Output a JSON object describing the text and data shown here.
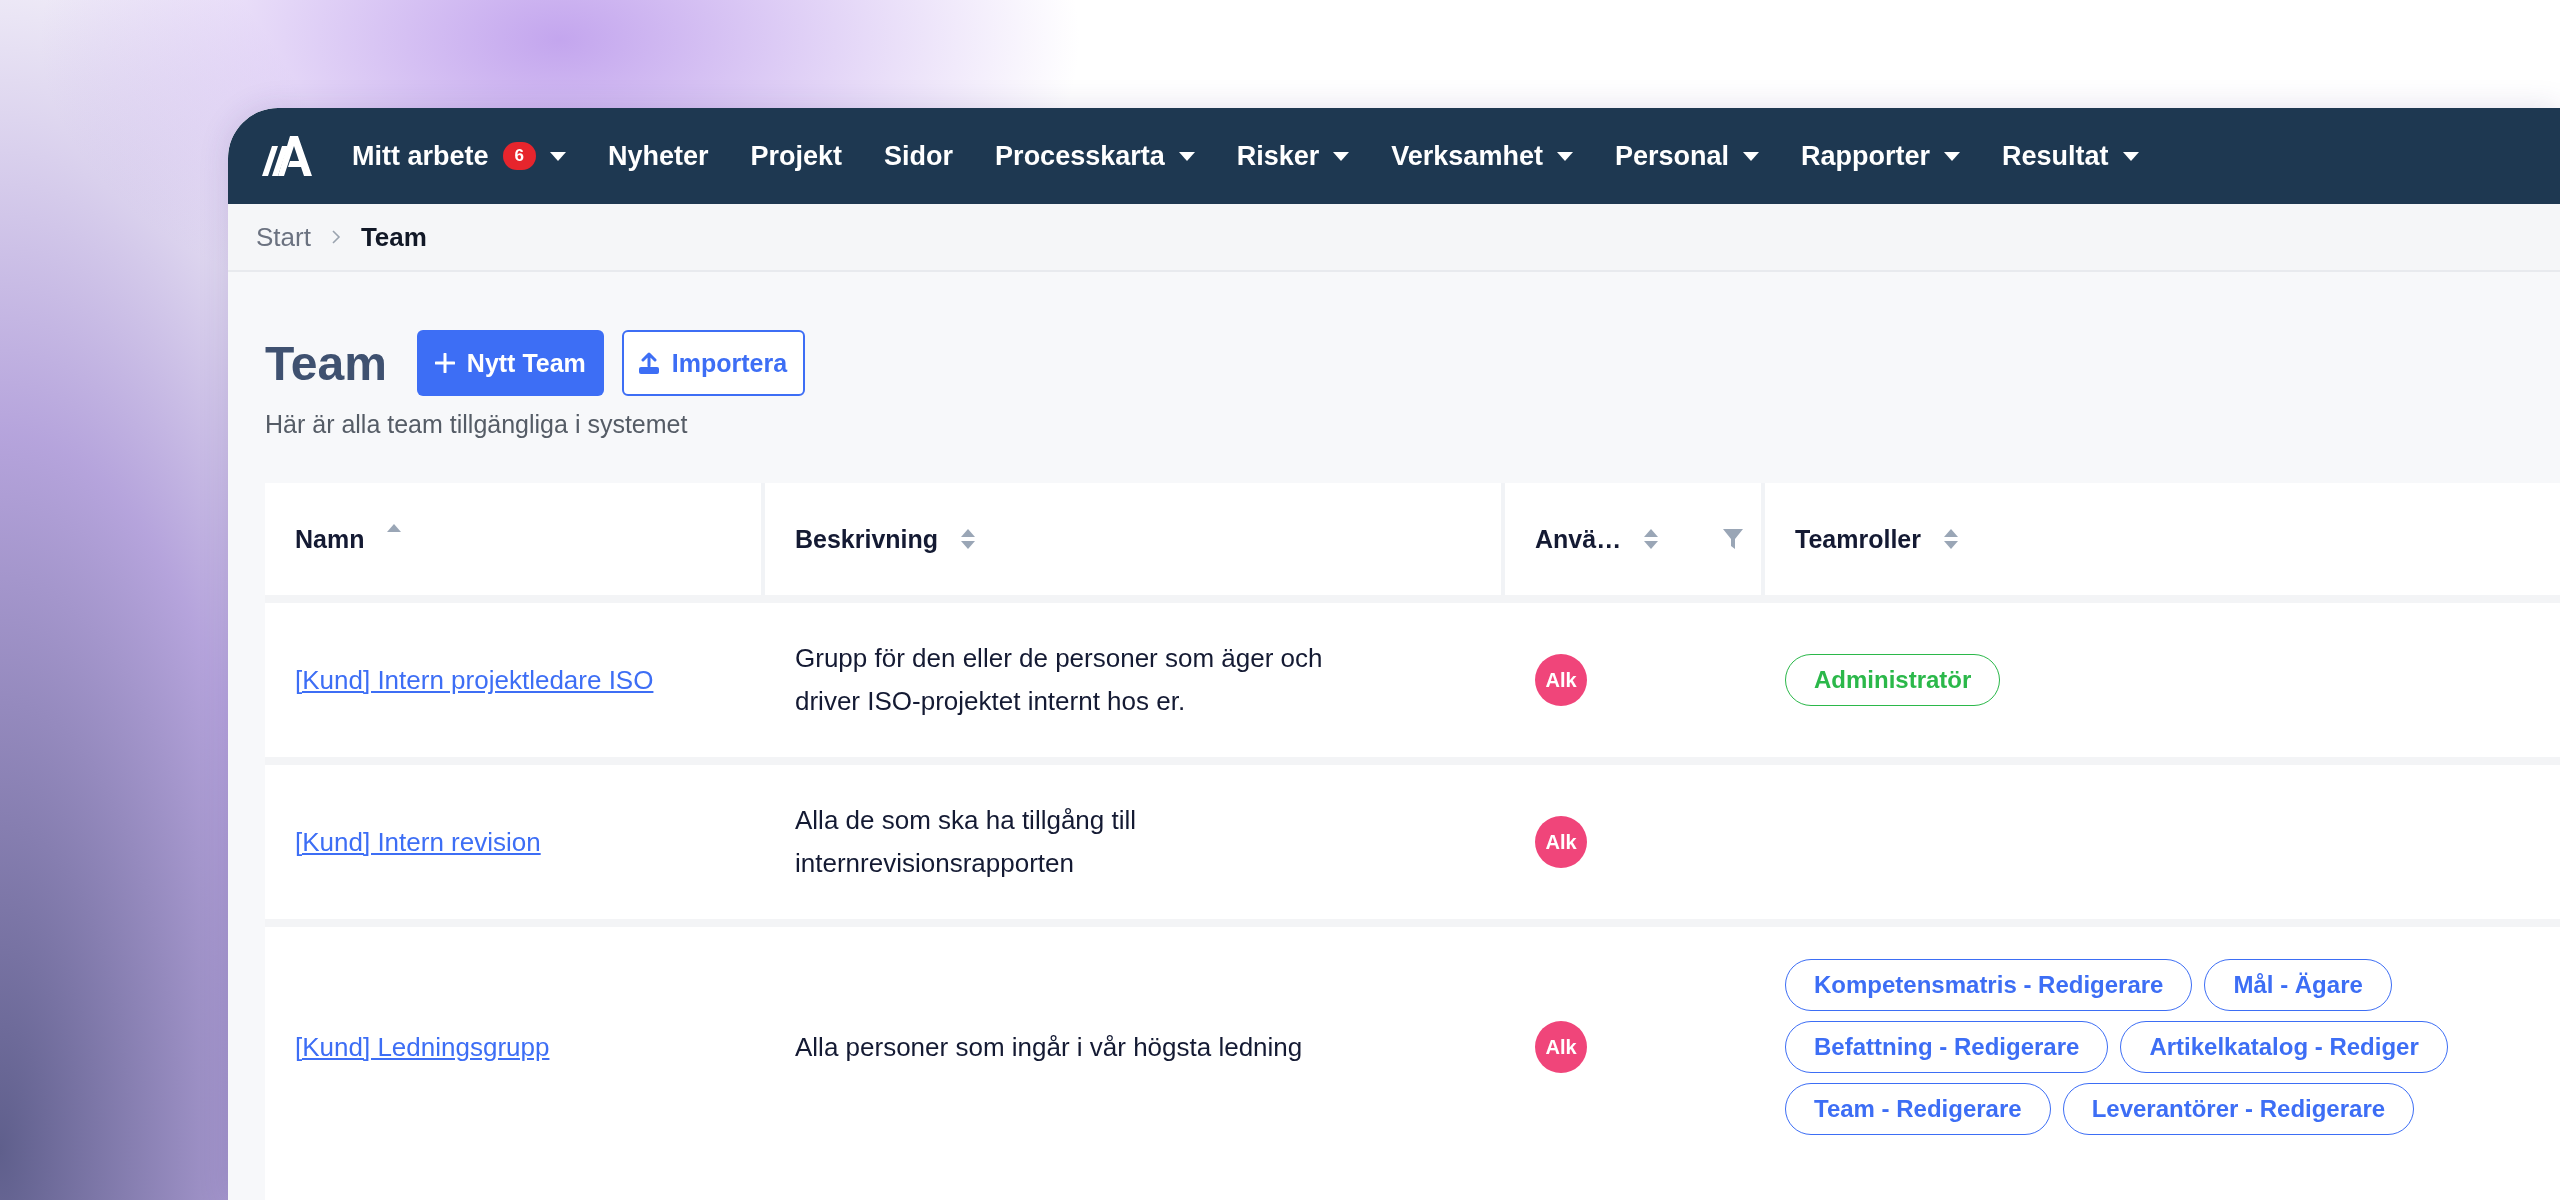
{
  "nav": {
    "items": [
      {
        "label": "Mitt arbete",
        "badge": "6",
        "has_menu": true
      },
      {
        "label": "Nyheter",
        "has_menu": false
      },
      {
        "label": "Projekt",
        "has_menu": false
      },
      {
        "label": "Sidor",
        "has_menu": false
      },
      {
        "label": "Processkarta",
        "has_menu": true
      },
      {
        "label": "Risker",
        "has_menu": true
      },
      {
        "label": "Verksamhet",
        "has_menu": true
      },
      {
        "label": "Personal",
        "has_menu": true
      },
      {
        "label": "Rapporter",
        "has_menu": true
      },
      {
        "label": "Resultat",
        "has_menu": true
      }
    ]
  },
  "breadcrumb": [
    {
      "label": "Start",
      "selected": false
    },
    {
      "label": "Team",
      "selected": true
    }
  ],
  "page": {
    "title": "Team",
    "subtitle": "Här är alla team tillgängliga i systemet",
    "buttons": [
      {
        "kind": "primary",
        "label": "Nytt Team"
      },
      {
        "kind": "import",
        "label": "Importera"
      }
    ]
  },
  "table": {
    "columns": [
      {
        "label": "Namn",
        "sorted": true,
        "filter": false
      },
      {
        "label": "Beskrivning",
        "sorted": false,
        "filter": false
      },
      {
        "label": "Anvä…",
        "sorted": false,
        "filter": true
      },
      {
        "label": "Teamroller",
        "sorted": false,
        "filter": false
      }
    ],
    "rows": [
      {
        "name": "[Kund] Intern projektledare ISO",
        "description": "Grupp för den eller de personer som äger och driver ISO-projektet internt hos er.",
        "users": [
          "Alk"
        ],
        "roles": [
          {
            "label": "Administratör",
            "color": "#2bb84a"
          }
        ]
      },
      {
        "name": "[Kund] Intern revision",
        "description": "Alla de som ska ha tillgång till internrevisionsrapporten",
        "users": [
          "Alk"
        ],
        "roles": []
      },
      {
        "name": "[Kund] Ledningsgrupp",
        "description": "Alla personer som ingår i vår högsta ledning",
        "users": [
          "Alk"
        ],
        "roles": [
          {
            "label": "Kompetensmatris - Redigerare",
            "color": "#3d6ef5"
          },
          {
            "label": "Mål - Ägare",
            "color": "#3d6ef5"
          },
          {
            "label": "Befattning - Redigerare",
            "color": "#3d6ef5"
          },
          {
            "label": "Artikelkatalog - Rediger",
            "color": "#3d6ef5"
          },
          {
            "label": "Team - Redigerare",
            "color": "#3d6ef5"
          },
          {
            "label": "Leverantörer - Redigerare",
            "color": "#3d6ef5"
          }
        ]
      }
    ]
  }
}
